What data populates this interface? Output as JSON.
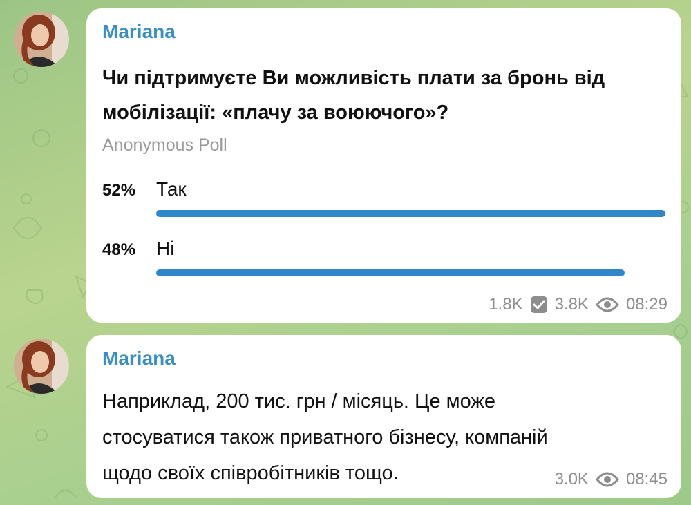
{
  "messages": [
    {
      "sender": "Mariana",
      "poll": {
        "question_line1": "Чи підтримуєте Ви можливість плати за бронь від",
        "question_line2": "мобілізації: «плачу за воюючого»?",
        "type": "Anonymous Poll",
        "options": [
          {
            "percent_label": "52%",
            "label": "Так",
            "fraction": 1.0
          },
          {
            "percent_label": "48%",
            "label": "Ні",
            "fraction": 0.92
          }
        ]
      },
      "votes": "1.8K",
      "views": "3.8K",
      "time": "08:29"
    },
    {
      "sender": "Mariana",
      "text_line1": "Наприклад, 200 тис. грн / місяць. Це може",
      "text_line2": "стосуватися також приватного бізнесу, компаній",
      "text_line3": "щодо своїх співробітників тощо.",
      "views": "3.0K",
      "time": "08:45"
    }
  ],
  "colors": {
    "accent": "#2f86c8",
    "sender": "#3a8fc2",
    "meta": "#8d8d8d"
  },
  "icons": [
    "check-square-icon",
    "eye-icon"
  ]
}
